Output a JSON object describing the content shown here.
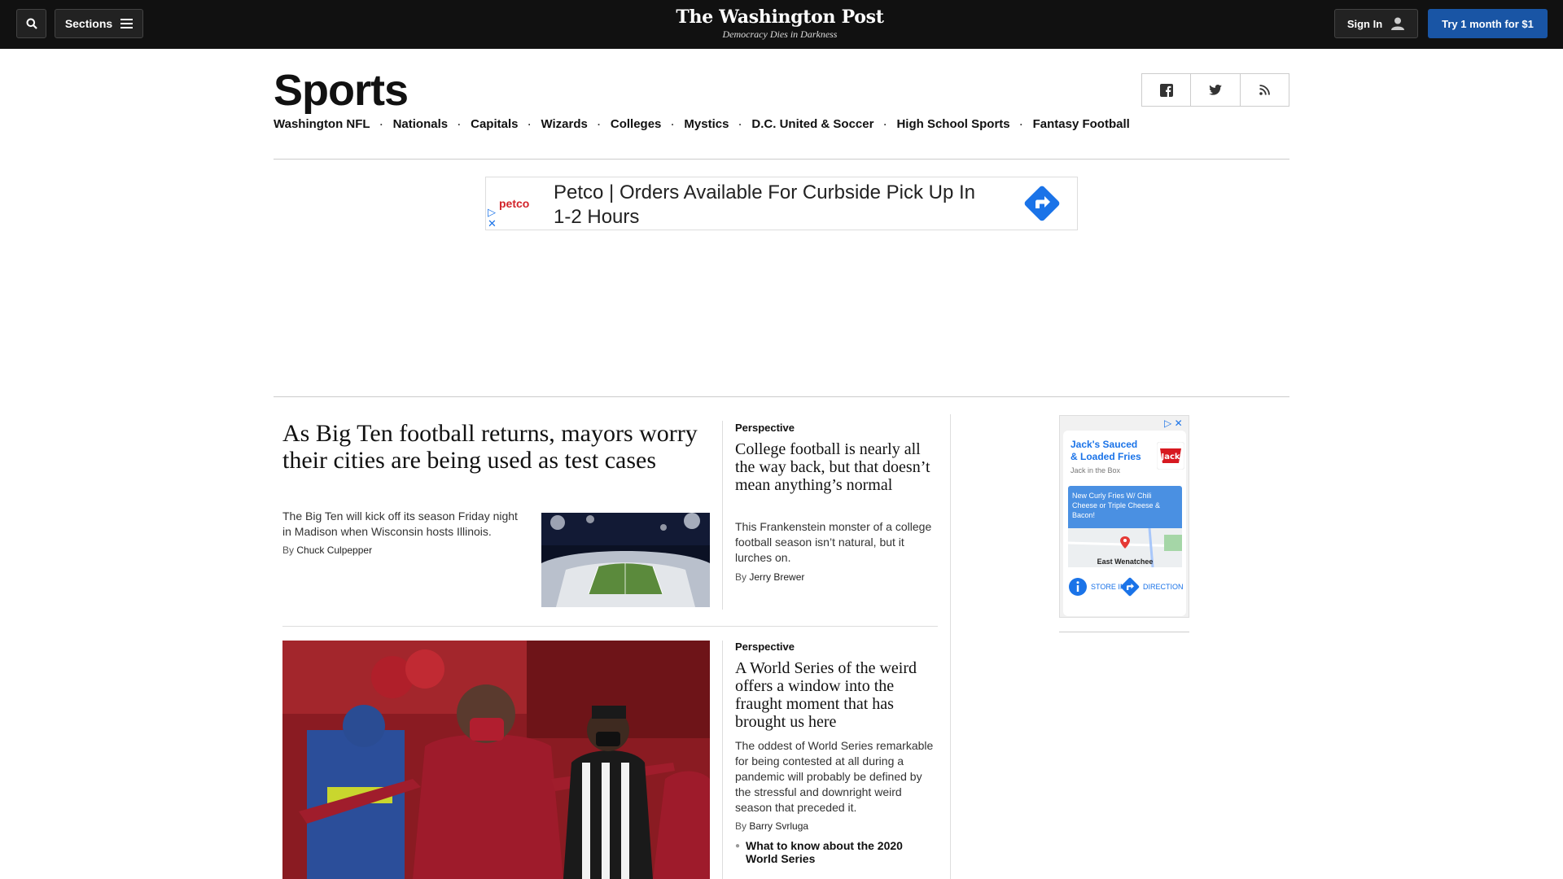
{
  "topbar": {
    "sections_label": "Sections",
    "brand_name": "The Washington Post",
    "brand_tagline": "Democracy Dies in Darkness",
    "signin_label": "Sign In",
    "subscribe_label": "Try 1 month for $1"
  },
  "section": {
    "title": "Sports",
    "nav": [
      "Washington NFL",
      "Nationals",
      "Capitals",
      "Wizards",
      "Colleges",
      "Mystics",
      "D.C. United & Soccer",
      "High School Sports",
      "Fantasy Football"
    ],
    "nav_separator": "·"
  },
  "ad_banner": {
    "brand": "petco",
    "text": "Petco | Orders Available For Curbside Pick Up In 1-2 Hours"
  },
  "stories": {
    "lead": {
      "headline": "As Big Ten football returns, mayors worry their cities are being used as test cases",
      "blurb": "The Big Ten will kick off its season Friday night in Madison when Wisconsin hosts Illinois.",
      "by": "By",
      "author": "Chuck Culpepper"
    },
    "second": {
      "kicker": "Perspective",
      "headline": "College football is nearly all the way back, but that doesn’t mean anything’s normal",
      "blurb": "This Frankenstein monster of a college football season isn’t natural, but it lurches on.",
      "by": "By",
      "author": "Jerry Brewer"
    },
    "third": {
      "kicker": "Perspective",
      "headline": "A World Series of the weird offers a window into the fraught moment that has brought us here",
      "blurb": "The oddest of World Series remarkable for being contested at all during a pandemic will probably be defined by the stressful and downright weird season that preceded it.",
      "by": "By",
      "author": "Barry Svrluga",
      "related": "What to know about the 2020 World Series"
    }
  },
  "rail_ad": {
    "title": "Jack's Sauced & Loaded Fries",
    "sponsor": "Jack in the Box",
    "promo": "New Curly Fries W/ Chili Cheese or Triple Cheese & Bacon!",
    "map_label": "East Wenatchee",
    "store_info": "STORE INFO",
    "directions": "DIRECTION"
  },
  "colors": {
    "topbar_bg": "#111111",
    "subscribe_bg": "#1955a5",
    "link_blue": "#1a73e8"
  }
}
